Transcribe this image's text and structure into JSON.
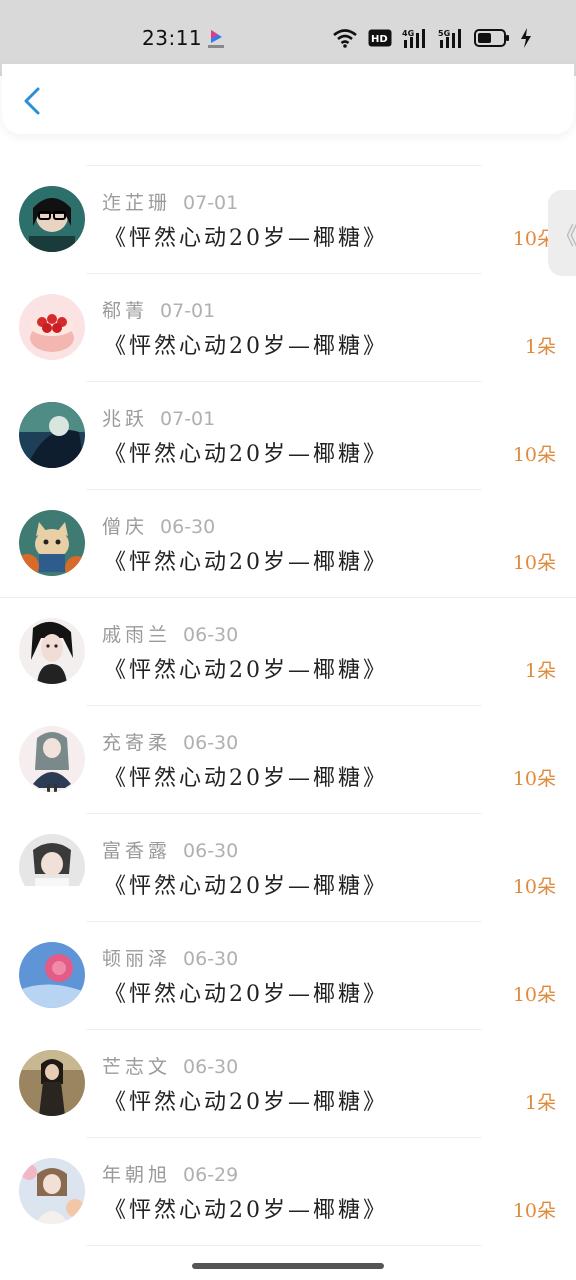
{
  "status_bar": {
    "time": "23:11",
    "icons": [
      "app-logo-icon",
      "wifi-icon",
      "hd-icon",
      "signal-4g-icon",
      "signal-5g-icon",
      "battery-icon",
      "charging-icon"
    ]
  },
  "header": {
    "back_icon": "chevron-left-icon"
  },
  "side_tab": {
    "icon": "chevron-left-icon",
    "glyph": "《"
  },
  "entries": [
    {
      "name": "迮芷珊",
      "date": "07-01",
      "message": "《怦然心动20岁—椰糖》",
      "count": "10朵"
    },
    {
      "name": "郗菁",
      "date": "07-01",
      "message": "《怦然心动20岁—椰糖》",
      "count": "1朵"
    },
    {
      "name": "兆跃",
      "date": "07-01",
      "message": "《怦然心动20岁—椰糖》",
      "count": "10朵"
    },
    {
      "name": "僧庆",
      "date": "06-30",
      "message": "《怦然心动20岁—椰糖》",
      "count": "10朵"
    },
    {
      "name": "戚雨兰",
      "date": "06-30",
      "message": "《怦然心动20岁—椰糖》",
      "count": "1朵"
    },
    {
      "name": "充寄柔",
      "date": "06-30",
      "message": "《怦然心动20岁—椰糖》",
      "count": "10朵"
    },
    {
      "name": "富香露",
      "date": "06-30",
      "message": "《怦然心动20岁—椰糖》",
      "count": "10朵"
    },
    {
      "name": "顿丽泽",
      "date": "06-30",
      "message": "《怦然心动20岁—椰糖》",
      "count": "10朵"
    },
    {
      "name": "芒志文",
      "date": "06-30",
      "message": "《怦然心动20岁—椰糖》",
      "count": "1朵"
    },
    {
      "name": "年朝旭",
      "date": "06-29",
      "message": "《怦然心动20岁—椰糖》",
      "count": "10朵"
    }
  ],
  "colors": {
    "count": "#e08a3c",
    "accent": "#2a8fd8",
    "name": "#9a9a9a"
  }
}
